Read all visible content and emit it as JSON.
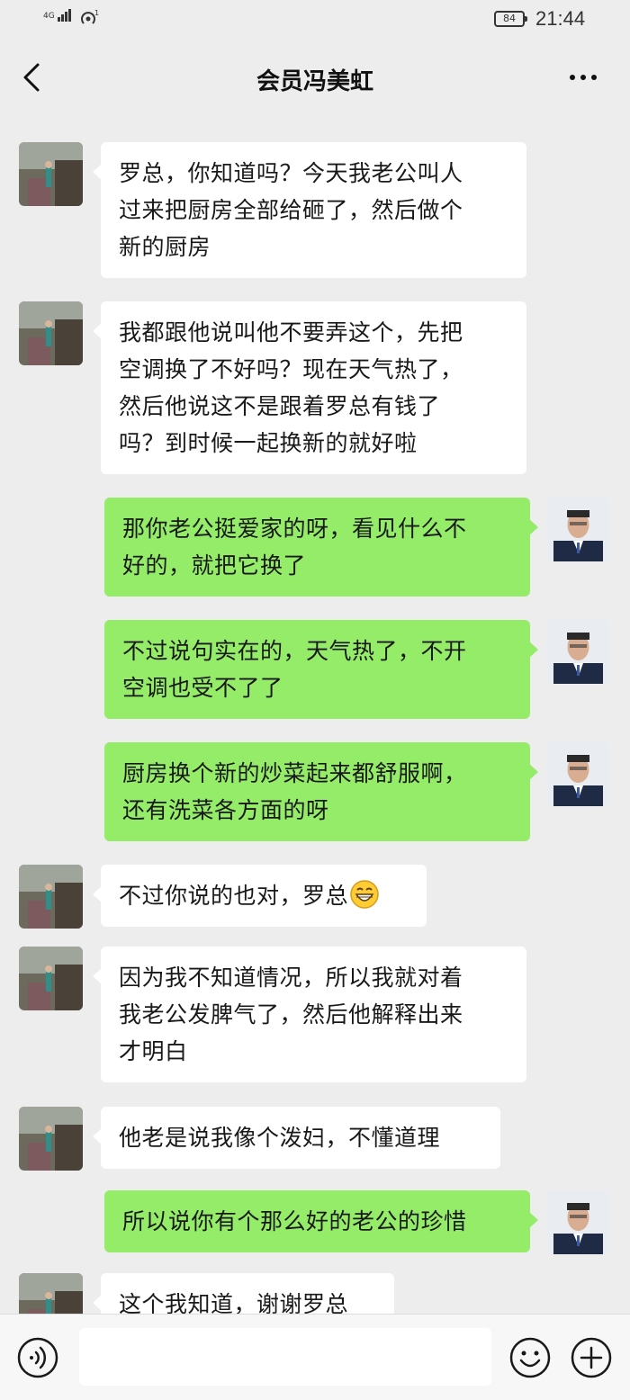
{
  "status_bar": {
    "network": "4G",
    "signal_icon": "cell-signal-icon",
    "wifi_icon": "wifi-hotspot-icon",
    "wifi_badge": "1",
    "battery": "84",
    "time": "21:44"
  },
  "nav": {
    "title": "会员冯美虹",
    "back_icon": "chevron-left-icon",
    "more_icon": "more-dots-icon"
  },
  "messages": [
    {
      "side": "left",
      "text": "罗总，你知道吗？今天我老公叫人\n过来把厨房全部给砸了，然后做个\n新的厨房"
    },
    {
      "side": "left",
      "text": "我都跟他说叫他不要弄这个，先把\n空调换了不好吗？现在天气热了，\n然后他说这不是跟着罗总有钱了\n吗？到时候一起换新的就好啦"
    },
    {
      "side": "right",
      "text": "那你老公挺爱家的呀，看见什么不\n好的，就把它换了"
    },
    {
      "side": "right",
      "text": "不过说句实在的，天气热了，不开\n空调也受不了了"
    },
    {
      "side": "right",
      "text": "厨房换个新的炒菜起来都舒服啊，\n还有洗菜各方面的呀"
    },
    {
      "side": "left",
      "text": "不过你说的也对，罗总",
      "emoji": "grinning-face-emoji"
    },
    {
      "side": "left",
      "text": "因为我不知道情况，所以我就对着\n我老公发脾气了，然后他解释出来\n才明白"
    },
    {
      "side": "left",
      "text": "他老是说我像个泼妇，不懂道理"
    },
    {
      "side": "right",
      "text": "所以说你有个那么好的老公的珍惜"
    },
    {
      "side": "left",
      "text": "这个我知道，谢谢罗总"
    }
  ],
  "input_bar": {
    "voice_icon": "voice-input-icon",
    "input_value": "",
    "emoji_icon": "emoji-smile-icon",
    "plus_icon": "plus-circle-icon"
  },
  "colors": {
    "background": "#ededed",
    "incoming_bubble": "#ffffff",
    "outgoing_bubble": "#95ec69"
  }
}
